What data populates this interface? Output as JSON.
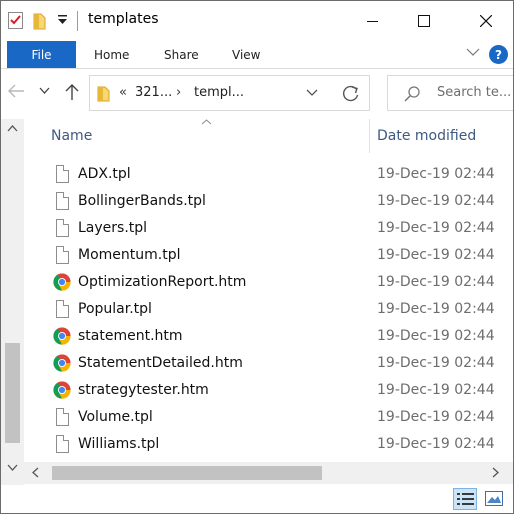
{
  "window": {
    "title": "templates"
  },
  "ribbon": {
    "tabs": [
      "File",
      "Home",
      "Share",
      "View"
    ],
    "help_label": "?"
  },
  "address": {
    "prefix": "«",
    "segments": [
      "321...",
      "templ..."
    ],
    "separator": "›"
  },
  "search": {
    "placeholder": "Search te..."
  },
  "columns": {
    "name": "Name",
    "date_modified": "Date modified"
  },
  "files": [
    {
      "name": "ADX.tpl",
      "date": "19-Dec-19 02:44",
      "icon": "document-icon"
    },
    {
      "name": "BollingerBands.tpl",
      "date": "19-Dec-19 02:44",
      "icon": "document-icon"
    },
    {
      "name": "Layers.tpl",
      "date": "19-Dec-19 02:44",
      "icon": "document-icon"
    },
    {
      "name": "Momentum.tpl",
      "date": "19-Dec-19 02:44",
      "icon": "document-icon"
    },
    {
      "name": "OptimizationReport.htm",
      "date": "19-Dec-19 02:44",
      "icon": "chrome-icon"
    },
    {
      "name": "Popular.tpl",
      "date": "19-Dec-19 02:44",
      "icon": "document-icon"
    },
    {
      "name": "statement.htm",
      "date": "19-Dec-19 02:44",
      "icon": "chrome-icon"
    },
    {
      "name": "StatementDetailed.htm",
      "date": "19-Dec-19 02:44",
      "icon": "chrome-icon"
    },
    {
      "name": "strategytester.htm",
      "date": "19-Dec-19 02:44",
      "icon": "chrome-icon"
    },
    {
      "name": "Volume.tpl",
      "date": "19-Dec-19 02:44",
      "icon": "document-icon"
    },
    {
      "name": "Williams.tpl",
      "date": "19-Dec-19 02:44",
      "icon": "document-icon"
    }
  ],
  "colors": {
    "accent": "#1a68c6",
    "header_text": "#3d5a80",
    "date_text": "#6d6d6d",
    "selected_view": "#cce4f7"
  }
}
